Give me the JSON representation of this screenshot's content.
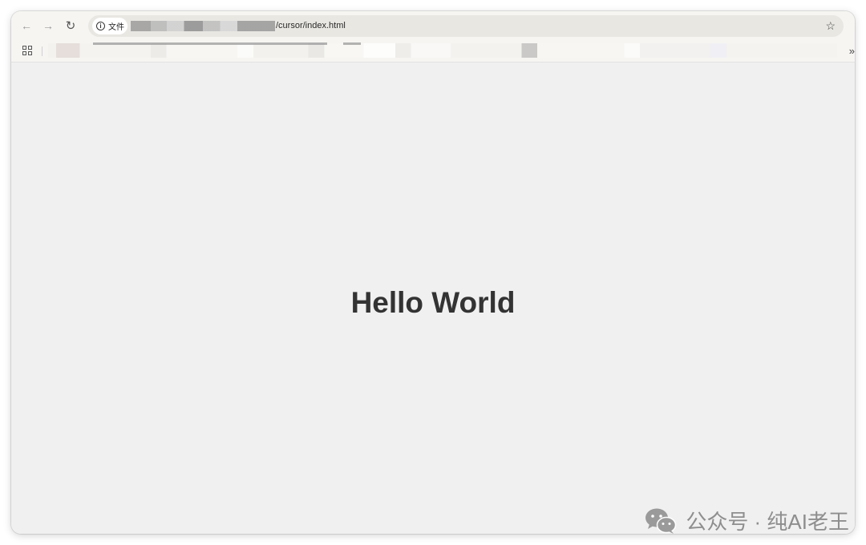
{
  "toolbar": {
    "back_icon": "arrow-left-icon",
    "forward_icon": "arrow-right-icon",
    "reload_icon": "reload-icon",
    "site_chip_label": "文件",
    "url_visible_part": "/cursor/index.html",
    "bookmark_star_icon": "star-icon"
  },
  "bookmarks_bar": {
    "apps_icon": "apps-grid-icon",
    "more_icon": "double-chevron-right-icon"
  },
  "page": {
    "heading": "Hello World",
    "background": "#f0f0f0",
    "text_color": "#333333"
  },
  "watermark": {
    "icon": "wechat-icon",
    "text": "公众号 · 纯AI老王"
  }
}
